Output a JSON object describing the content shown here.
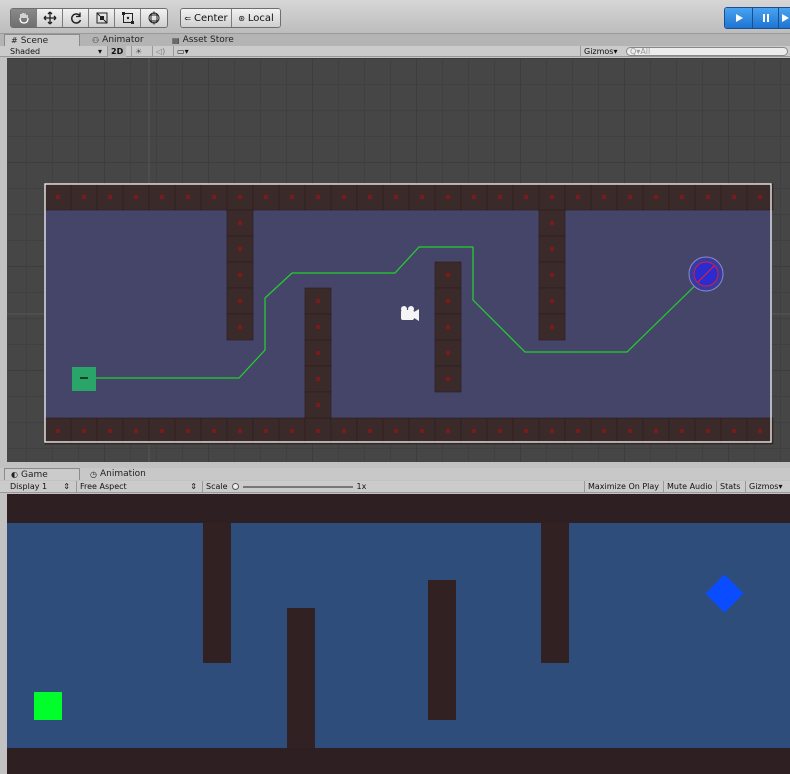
{
  "toolbar": {
    "tools": [
      "hand-tool",
      "move-tool",
      "rotate-tool",
      "scale-tool",
      "rect-tool",
      "transform-tool"
    ],
    "pivot_label": "Center",
    "space_label": "Local"
  },
  "scene_tabs": [
    {
      "label": "Scene",
      "icon": "#"
    },
    {
      "label": "Animator",
      "icon": "animator"
    },
    {
      "label": "Asset Store",
      "icon": "store"
    }
  ],
  "scene_options": {
    "shading": "Shaded",
    "mode_2d": "2D",
    "gizmos_label": "Gizmos",
    "search_placeholder": "All",
    "search_prefix": "Q▾"
  },
  "game_tabs": [
    {
      "label": "Game",
      "icon": "game"
    },
    {
      "label": "Animation",
      "icon": "animation"
    }
  ],
  "game_options": {
    "display": "Display 1",
    "aspect": "Free Aspect",
    "scale_label": "Scale",
    "scale_value": "1x",
    "maximize": "Maximize On Play",
    "mute": "Mute Audio",
    "stats": "Stats",
    "gizmos": "Gizmos"
  },
  "colors": {
    "scene_bg": "#464646",
    "floor": "#45456a",
    "wall": "#3b2a2a",
    "wall_dot": "#7a1a1a",
    "path": "#22d22b",
    "start": "#2aa56a",
    "goal": "#2b2bd0",
    "game_floor": "#2f4d7a",
    "game_wall": "#312122",
    "game_player": "#00ff2a",
    "game_goal": "#0a4cff",
    "play_accent": "#1e74d2"
  }
}
